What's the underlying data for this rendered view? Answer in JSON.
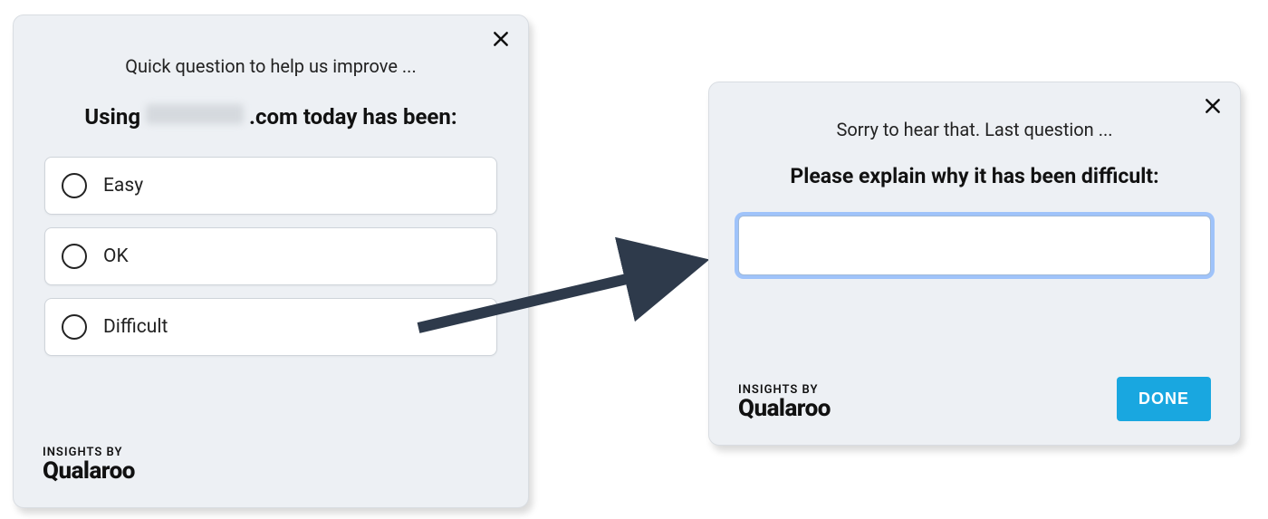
{
  "card1": {
    "subtitle": "Quick question to help us improve ...",
    "question_prefix": "Using",
    "question_suffix": ".com today has been:",
    "options": [
      "Easy",
      "OK",
      "Difficult"
    ]
  },
  "card2": {
    "subtitle": "Sorry to hear that. Last question ...",
    "question": "Please explain why it has been difficult:",
    "input_value": "",
    "done_label": "DONE"
  },
  "brand": {
    "by": "INSIGHTS BY",
    "name": "Qualaroo"
  }
}
